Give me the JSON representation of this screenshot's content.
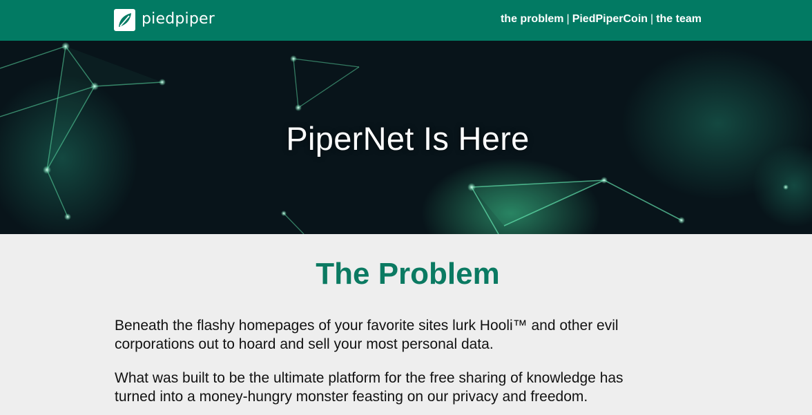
{
  "header": {
    "brand_name": "piedpiper",
    "logo_icon": "leaf-logo-icon",
    "nav": [
      {
        "label": "the problem"
      },
      {
        "label": "PiedPiperCoin"
      },
      {
        "label": "the team"
      }
    ],
    "separator": "|",
    "colors": {
      "bar": "#027a63",
      "text": "#ffffff"
    }
  },
  "hero": {
    "title": "PiperNet Is Here",
    "background": "dark-network-graphic",
    "colors": {
      "base": "#08141a",
      "glow": "#4ed8a0"
    }
  },
  "main": {
    "section_title": "The Problem",
    "paragraphs": [
      "Beneath the flashy homepages of your favorite sites lurk Hooli™ and other evil corporations out to hoard and sell your most personal data.",
      "What was built to be the ultimate platform for the free sharing of knowledge has turned into a money-hungry monster feasting on our privacy and freedom."
    ],
    "colors": {
      "title": "#0b7a62",
      "text": "#111111",
      "background": "#eeeeee"
    }
  }
}
